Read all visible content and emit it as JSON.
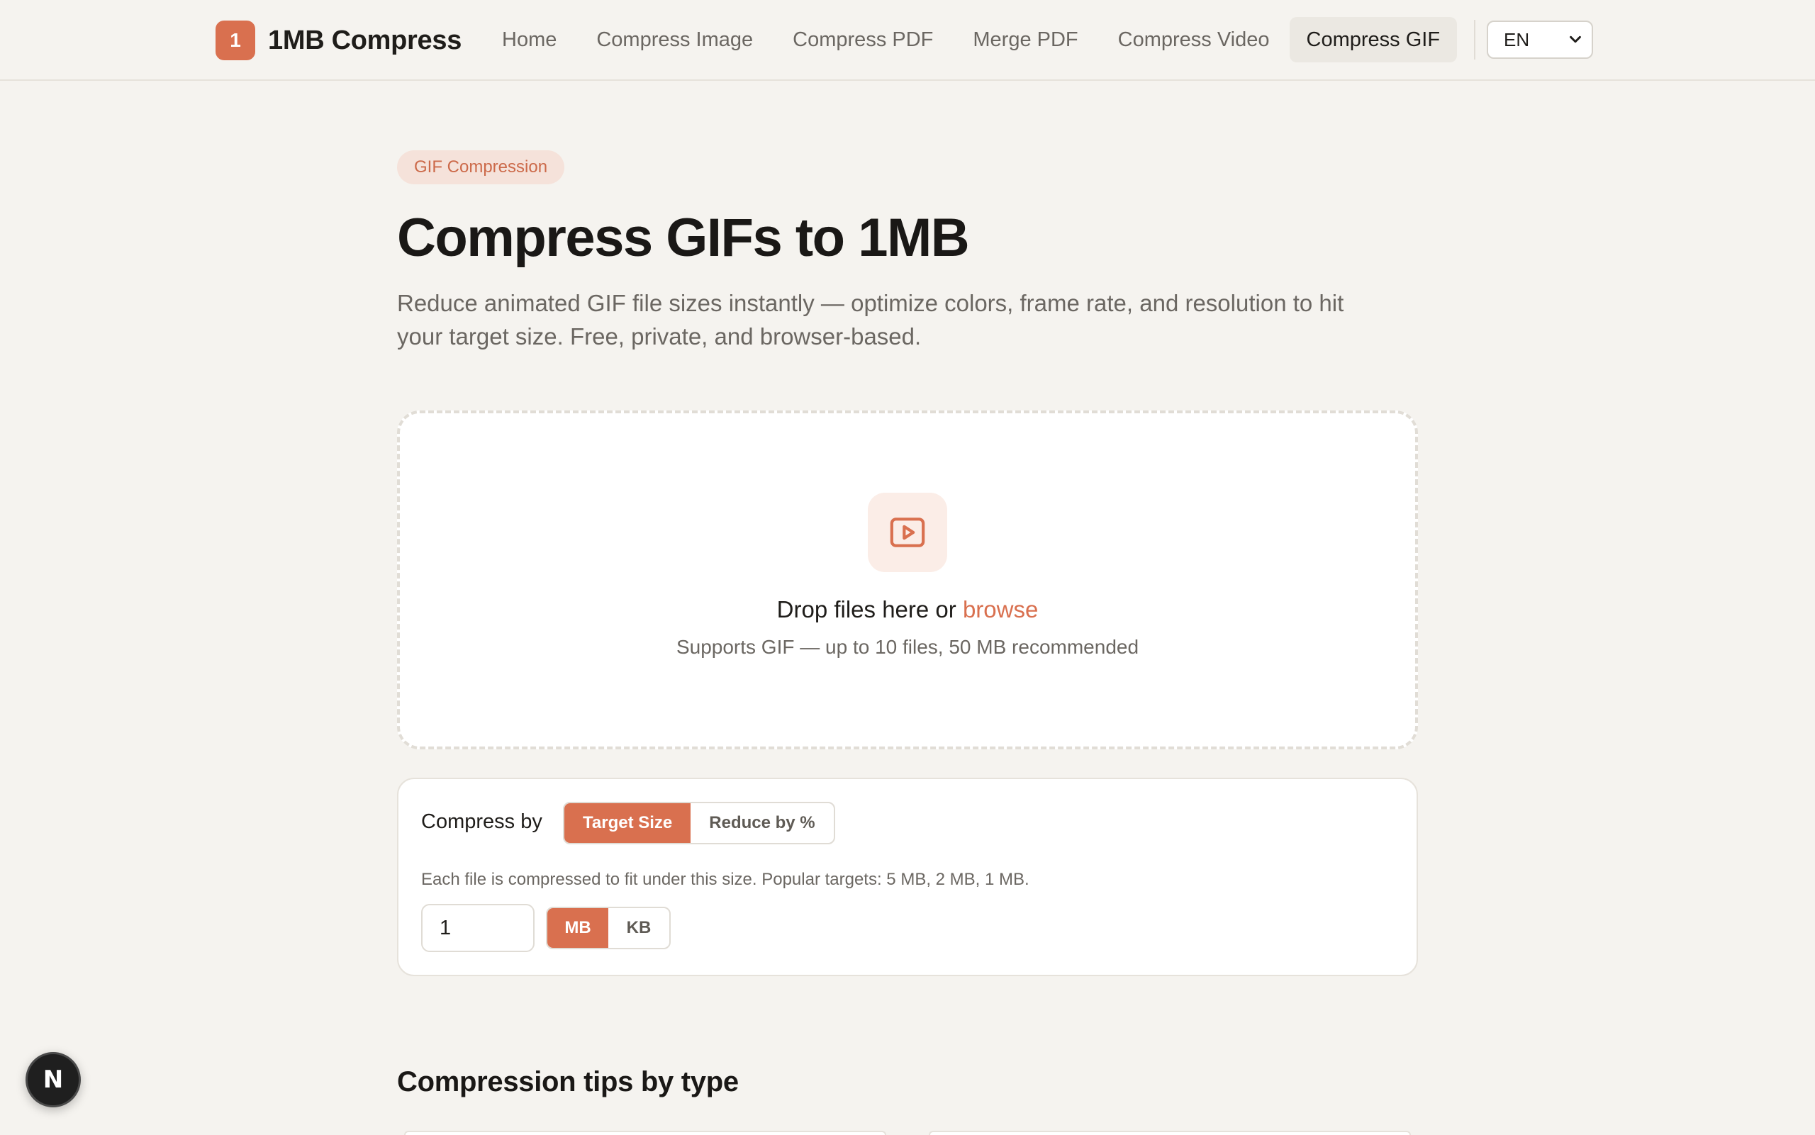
{
  "brand": {
    "badge": "1",
    "name": "1MB Compress"
  },
  "nav": {
    "items": [
      {
        "label": "Home"
      },
      {
        "label": "Compress Image"
      },
      {
        "label": "Compress PDF"
      },
      {
        "label": "Merge PDF"
      },
      {
        "label": "Compress Video"
      },
      {
        "label": "Compress GIF",
        "active": true
      }
    ],
    "language": "EN"
  },
  "hero": {
    "eyebrow": "GIF Compression",
    "title": "Compress GIFs to 1MB",
    "lead": "Reduce animated GIF file sizes instantly — optimize colors, frame rate, and resolution to hit your target size. Free, private, and browser-based."
  },
  "dropzone": {
    "icon": "play-frame-icon",
    "title_prefix": "Drop files here or ",
    "browse": "browse",
    "subtitle": "Supports GIF — up to 10 files, 50 MB recommended"
  },
  "options": {
    "label": "Compress by",
    "modes": [
      "Target Size",
      "Reduce by %"
    ],
    "selected_mode": "Target Size",
    "hint": "Each file is compressed to fit under this size. Popular targets: 5 MB, 2 MB, 1 MB.",
    "size_value": "1",
    "units": [
      "MB",
      "KB"
    ],
    "selected_unit": "MB"
  },
  "tips": {
    "title": "Compression tips by type"
  },
  "dev_badge": {
    "letter": "N"
  },
  "colors": {
    "accent": "#d9704f",
    "background": "#f5f3ef",
    "accent_soft": "#f5e2da"
  }
}
